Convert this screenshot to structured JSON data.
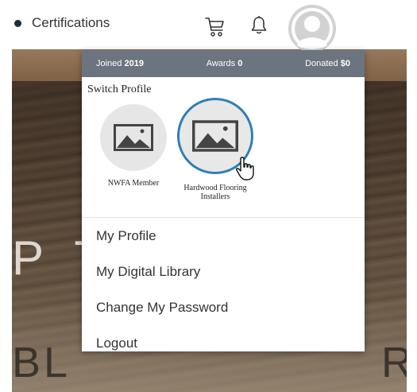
{
  "header": {
    "nav_certifications": "Certifications"
  },
  "hero": {
    "line1": "P T",
    "line2": "BL",
    "line3": "R"
  },
  "dropdown": {
    "stats": {
      "joined_label": "Joined",
      "joined_value": "2019",
      "awards_label": "Awards",
      "awards_value": "0",
      "donated_label": "Donated",
      "donated_value": "$0"
    },
    "switch_profile_title": "Switch Profile",
    "profiles": [
      {
        "name": "NWFA Member",
        "active": false
      },
      {
        "name": "Hardwood Flooring Installers",
        "active": true
      }
    ],
    "menu": [
      {
        "label": "My Profile"
      },
      {
        "label": "My Digital Library"
      },
      {
        "label": "Change My Password"
      },
      {
        "label": "Logout"
      }
    ]
  },
  "colors": {
    "stats_bar": "#6c7480",
    "active_ring": "#2f7fb4"
  },
  "icons": [
    "cart-icon",
    "bell-icon",
    "user-avatar-icon",
    "image-placeholder-icon",
    "hand-pointer-icon"
  ]
}
